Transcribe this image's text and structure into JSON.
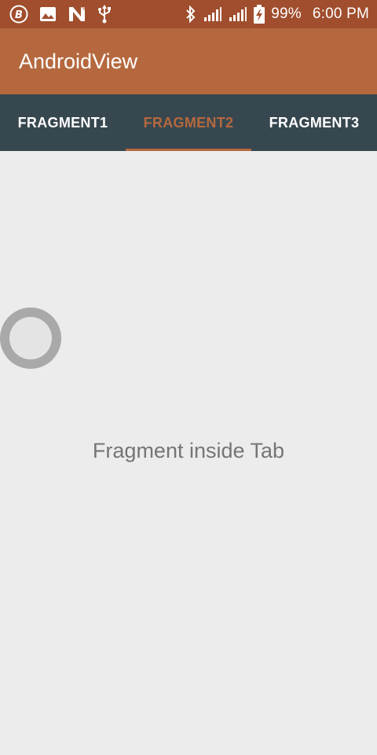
{
  "status_bar": {
    "icons_left": [
      "bitcoin-icon",
      "image-icon",
      "n-icon",
      "usb-icon"
    ],
    "icons_right": [
      "bluetooth-icon",
      "signal-icon",
      "signal-icon",
      "battery-charging-icon"
    ],
    "battery": "99%",
    "time": "6:00 PM"
  },
  "app_bar": {
    "title": "AndroidView"
  },
  "tabs": [
    {
      "label": "FRAGMENT1",
      "active": false
    },
    {
      "label": "FRAGMENT2",
      "active": true
    },
    {
      "label": "FRAGMENT3",
      "active": false
    }
  ],
  "content": {
    "text": "Fragment inside Tab"
  },
  "colors": {
    "status_bar": "#a04e2d",
    "app_bar": "#b5683e",
    "tab_bar": "#37474f",
    "accent": "#b5683e",
    "background": "#ececec",
    "text": "#757575"
  }
}
